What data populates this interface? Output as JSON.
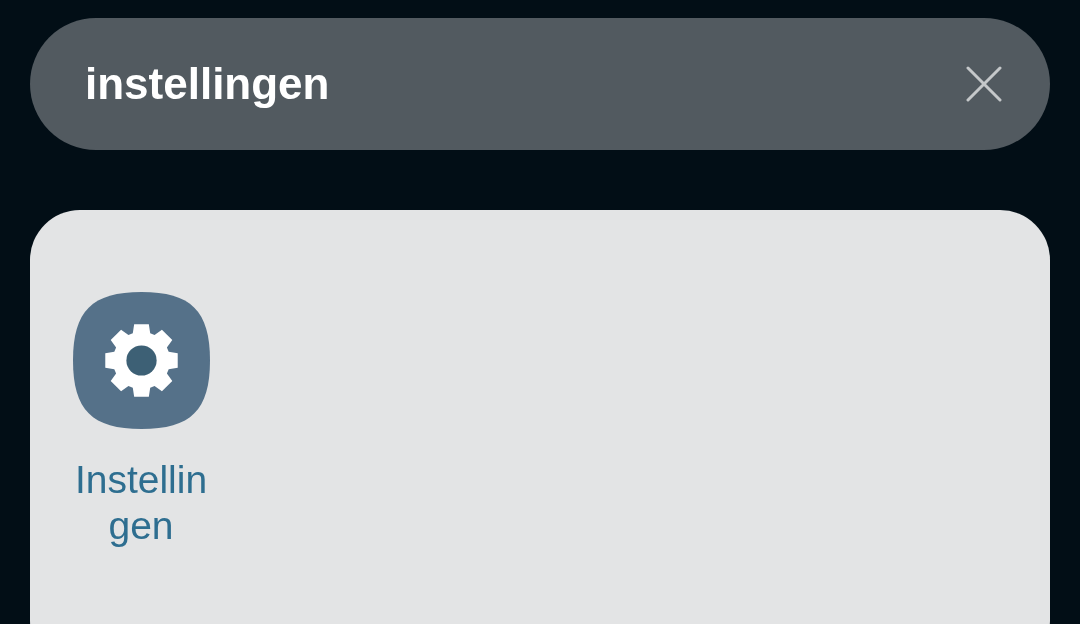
{
  "search": {
    "value": "instellingen"
  },
  "results": [
    {
      "label": "Instellingen"
    }
  ]
}
